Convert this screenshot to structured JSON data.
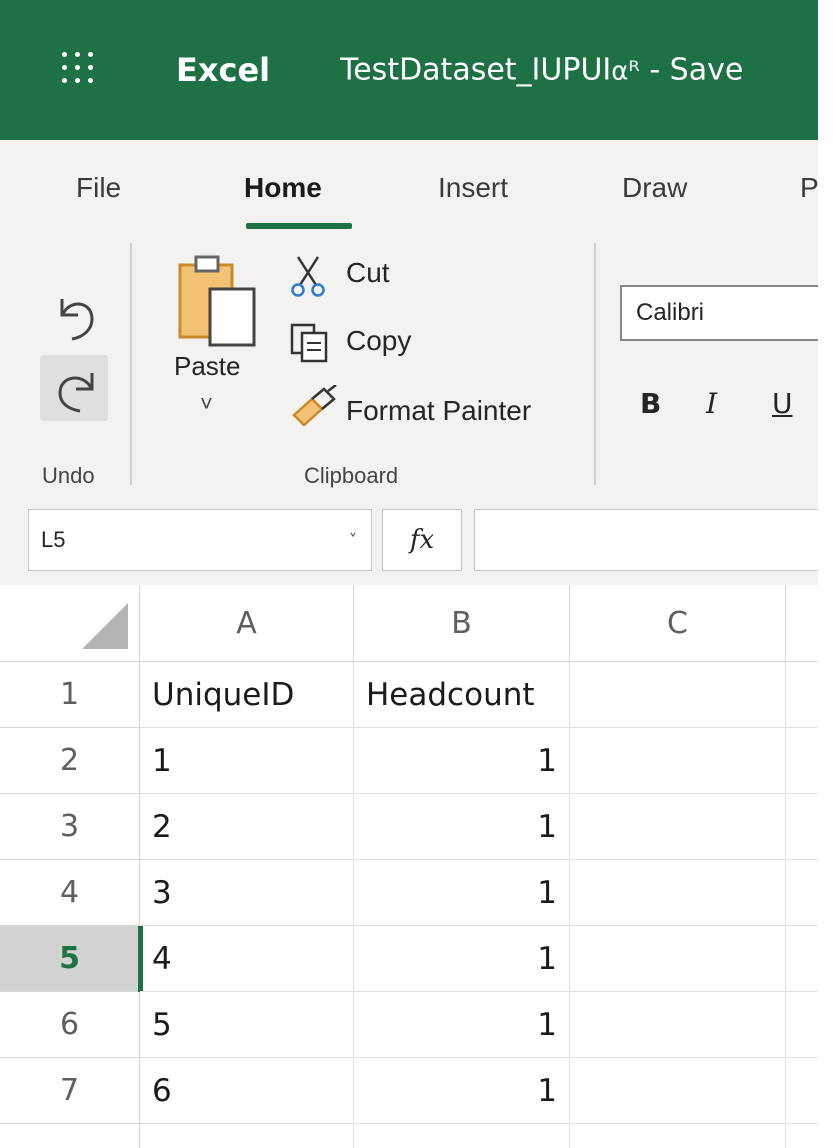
{
  "titlebar": {
    "app_name": "Excel",
    "doc_title": "TestDataset_IUPUI",
    "share_glyph": "αᴿ",
    "save_status": " - Save"
  },
  "tabs": [
    {
      "label": "File"
    },
    {
      "label": "Home"
    },
    {
      "label": "Insert"
    },
    {
      "label": "Draw"
    },
    {
      "label": "P"
    }
  ],
  "ribbon": {
    "undo_group_label": "Undo",
    "clipboard_group_label": "Clipboard",
    "paste_label": "Paste",
    "paste_caret": "˅",
    "cut_label": "Cut",
    "copy_label": "Copy",
    "format_painter_label": "Format Painter",
    "font_name": "Calibri",
    "bold": "B",
    "italic": "I",
    "underline": "U"
  },
  "formula_bar": {
    "name_box_value": "L5",
    "name_box_caret": "˅",
    "fx_label": "fx",
    "formula_value": ""
  },
  "sheet": {
    "columns": [
      "A",
      "B",
      "C"
    ],
    "rows": [
      {
        "num": "1",
        "a": "UniqueID",
        "b": "Headcount",
        "c": ""
      },
      {
        "num": "2",
        "a": "1",
        "b": "1",
        "c": ""
      },
      {
        "num": "3",
        "a": "2",
        "b": "1",
        "c": ""
      },
      {
        "num": "4",
        "a": "3",
        "b": "1",
        "c": ""
      },
      {
        "num": "5",
        "a": "4",
        "b": "1",
        "c": ""
      },
      {
        "num": "6",
        "a": "5",
        "b": "1",
        "c": ""
      },
      {
        "num": "7",
        "a": "6",
        "b": "1",
        "c": ""
      }
    ],
    "selected_row": "5"
  },
  "colors": {
    "brand_green": "#1e7145",
    "ribbon_bg": "#f3f2f1"
  }
}
